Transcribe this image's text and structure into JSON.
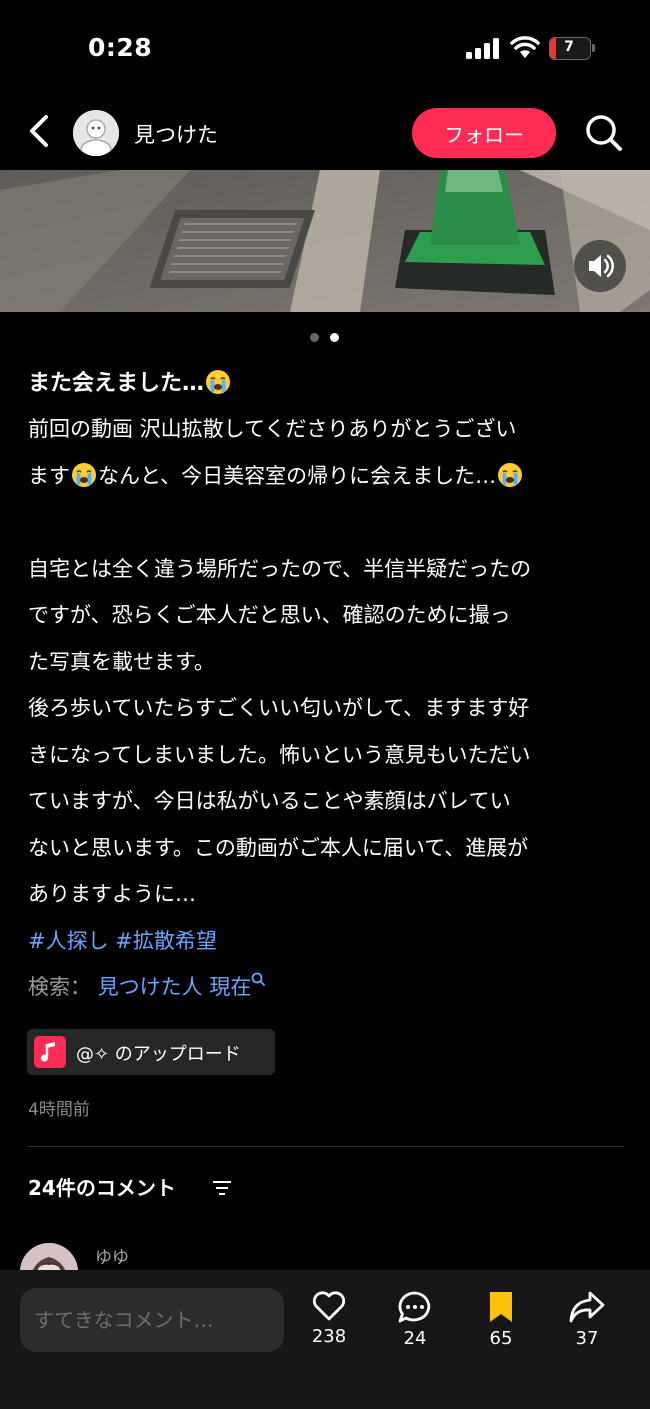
{
  "status_bar": {
    "time": "0:28",
    "battery": "7"
  },
  "header": {
    "username": "見つけた",
    "follow_label": "フォロー"
  },
  "post": {
    "title": "また会えました…",
    "body_lines": [
      "前回の動画 沢山拡散してくださりありがとうござい",
      "ます",
      "なんと、今日美容室の帰りに会えました…"
    ],
    "paragraph2": [
      "自宅とは全く違う場所だったので、半信半疑だったの",
      "ですが、恐らくご本人だと思い、確認のために撮っ",
      "た写真を載せます。",
      "後ろ歩いていたらすごくいい匂いがして、ますます好",
      "きになってしまいました。怖いという意見もいただい",
      "ていますが、今日は私がいることや素顔はバレてい",
      "ないと思います。この動画がご本人に届いて、進展が",
      "ありますように…"
    ],
    "hashtags": [
      "#人探し",
      "#拡散希望"
    ],
    "search_label": "検索：",
    "search_query": "見つけた人 現在",
    "music": "@✧ のアップロード",
    "time_ago": "4時間前"
  },
  "comments": {
    "header": "24件のコメント",
    "first_user": "ゆゆ"
  },
  "bottom_bar": {
    "placeholder": "すてきなコメント…",
    "likes": "238",
    "comments": "24",
    "saves": "65",
    "shares": "37"
  },
  "colors": {
    "accent": "#fe2c55",
    "link": "#6aa3ff",
    "bookmark": "#ffc107"
  },
  "icons": [
    "back-icon",
    "avatar-icon",
    "search-icon",
    "sound-icon",
    "crying-emoji-icon",
    "music-note-icon",
    "sort-icon",
    "heart-icon",
    "comment-icon",
    "bookmark-icon",
    "share-icon"
  ]
}
